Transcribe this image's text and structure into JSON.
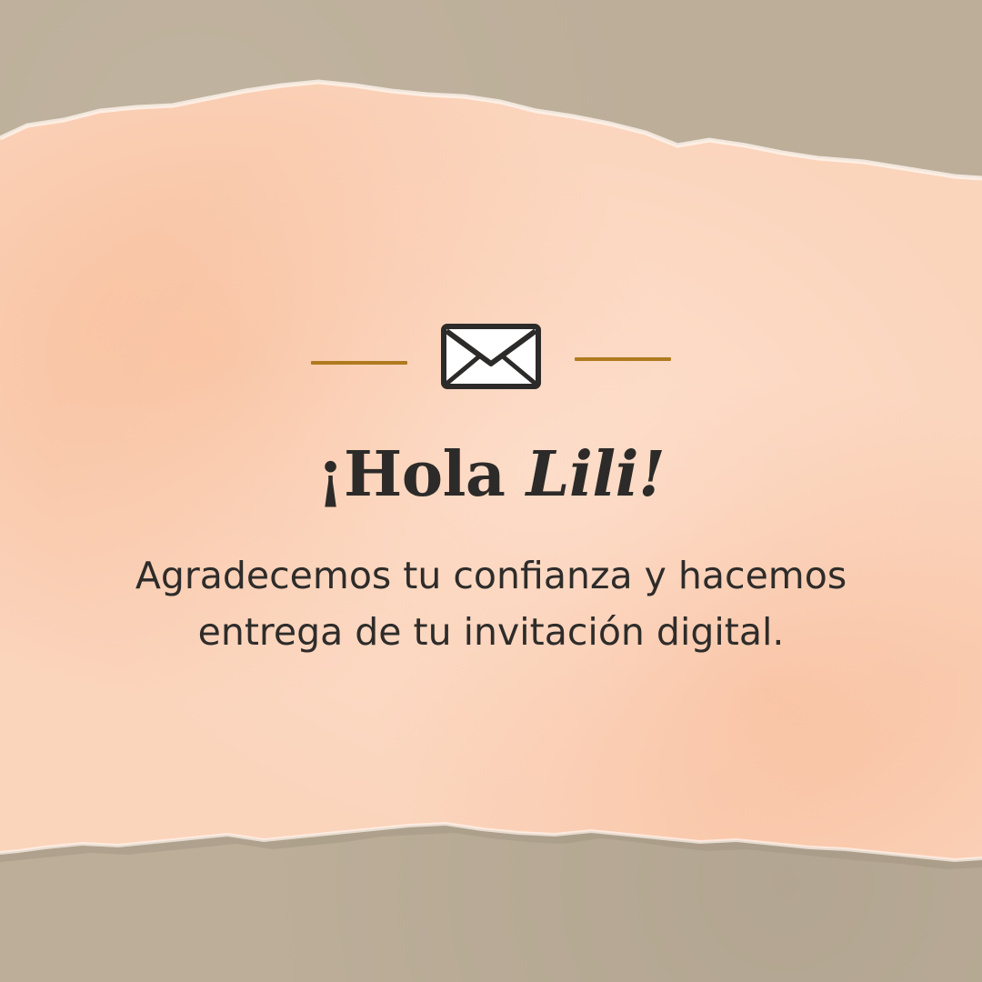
{
  "card": {
    "greeting_prefix": "¡Hola ",
    "greeting_name": "Lili!",
    "message_line1": "Agradecemos tu confianza y hacemos",
    "message_line2": "entrega de tu invitación digital.",
    "icon": "envelope-icon"
  },
  "colors": {
    "background_kraft": "#bcae99",
    "paper_peach": "#fbd3bb",
    "accent_rule": "#b07a1e",
    "text": "#2d2b29"
  }
}
